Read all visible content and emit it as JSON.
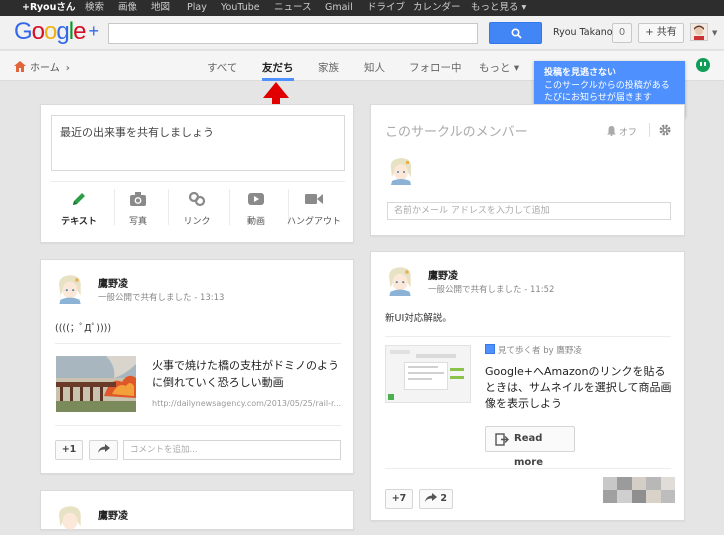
{
  "topbar": {
    "items": [
      "+Ryouさん",
      "検索",
      "画像",
      "地図",
      "Play",
      "YouTube",
      "ニュース",
      "Gmail",
      "ドライブ",
      "カレンダー",
      "もっと見る ▾"
    ]
  },
  "header": {
    "logo_text": "Google",
    "logo_plus": "+",
    "username": "Ryou Takano",
    "notification_count": "0",
    "share_label": "+ 共有"
  },
  "nav": {
    "home_label": "ホーム",
    "tabs": [
      "すべて",
      "友だち",
      "家族",
      "知人",
      "フォロー中",
      "もっと ▾"
    ],
    "active_tab": "友だち"
  },
  "tooltip": {
    "title": "投稿を見逃さない",
    "body": "このサークルからの投稿があるたびにお知らせが届きます"
  },
  "composer": {
    "placeholder": "最近の出来事を共有しましょう",
    "tools": [
      "テキスト",
      "写真",
      "リンク",
      "動画",
      "ハングアウト"
    ]
  },
  "circle_card": {
    "title": "このサークルのメンバー",
    "notify_label": "オフ",
    "input_placeholder": "名前かメール アドレスを入力して追加"
  },
  "post1": {
    "author": "鷹野凌",
    "meta": "一般公開で共有しました  -  13:13",
    "text": "((((；ﾟДﾟ))))",
    "link_title": "火事で焼けた橋の支柱がドミノのように倒れていく恐ろしい動画",
    "link_url": "http://dailynewsagency.com/2013/05/25/rail-r...",
    "plus_one": "+1",
    "comment_placeholder": "コメントを追加..."
  },
  "post2": {
    "author": "鷹野凌",
    "meta": "一般公開で共有しました  -  11:52",
    "text": "新UI対応解説。",
    "app_source": "見て歩く者 by 鷹野凌",
    "app_title": "Google+へAmazonのリンクを貼るときは、サムネイルを選択して商品画像を表示しよう",
    "read_more": "Read more",
    "plus_count": "+7",
    "share_count": "2"
  },
  "post3": {
    "author": "鷹野凌"
  },
  "colors": {
    "accent_blue": "#4d90fe",
    "search_button": "#4285f4",
    "annotation_red": "#e00000"
  }
}
